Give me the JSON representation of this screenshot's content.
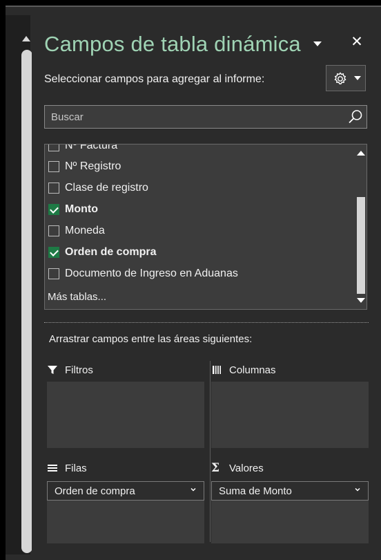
{
  "pane": {
    "title": "Campos de tabla dinámica",
    "instruction": "Seleccionar campos para agregar al informe:",
    "search_placeholder": "Buscar",
    "search_value": ""
  },
  "fields": {
    "partial_item": "Nº Factura",
    "items": [
      {
        "label": "Nº Registro",
        "checked": false
      },
      {
        "label": "Clase de registro",
        "checked": false
      },
      {
        "label": "Monto",
        "checked": true
      },
      {
        "label": "Moneda",
        "checked": false
      },
      {
        "label": "Orden de compra",
        "checked": true
      },
      {
        "label": "Documento de Ingreso en Aduanas",
        "checked": false
      }
    ],
    "more_tables": "Más tablas..."
  },
  "areas": {
    "hint": "Arrastrar campos entre las áreas siguientes:",
    "filters": {
      "label": "Filtros"
    },
    "columns": {
      "label": "Columnas"
    },
    "rows": {
      "label": "Filas",
      "field": "Orden de compra"
    },
    "values": {
      "label": "Valores",
      "field": "Suma de Monto"
    }
  },
  "colors": {
    "title": "#9fd3b4",
    "check_accent": "#1e7a45",
    "pane_background": "#2b2b2b",
    "zone_background": "#3c3c3c"
  },
  "icons": [
    "dropdown-caret-icon",
    "close-icon",
    "gear-icon",
    "search-icon",
    "checkmark-icon",
    "filter-icon",
    "columns-icon",
    "rows-icon",
    "sigma-icon",
    "chevron-down-icon"
  ]
}
